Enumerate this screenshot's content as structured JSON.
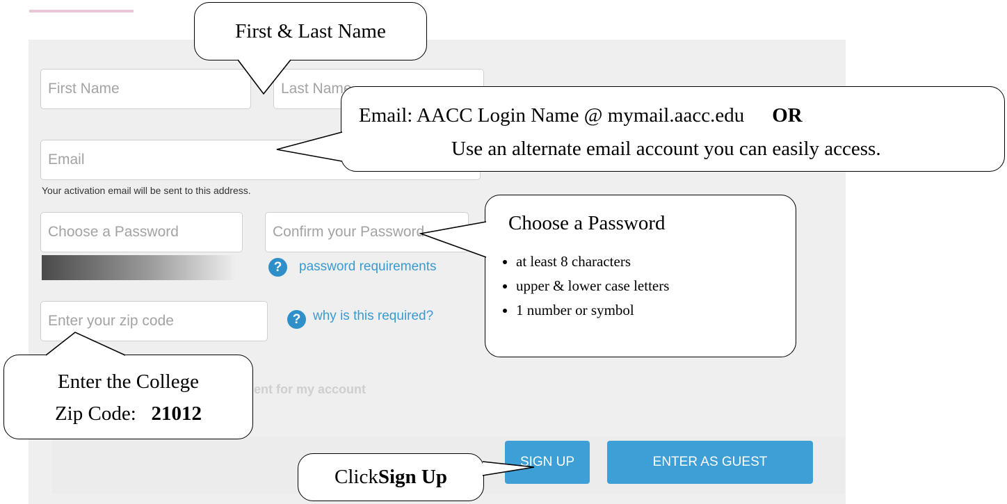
{
  "form": {
    "first_name_placeholder": "First Name",
    "last_name_placeholder": "Last Name",
    "email_placeholder": "Email",
    "email_hint": "Your activation email will be sent to this address.",
    "password_placeholder": "Choose a Password",
    "confirm_password_placeholder": "Confirm your Password",
    "password_requirements_link": "password requirements",
    "zip_placeholder": "Enter your zip code",
    "zip_help_link": "why is this required?",
    "consent_text_visible": "ent for my account",
    "sign_up_button": "SIGN UP",
    "guest_button": "ENTER AS GUEST"
  },
  "callouts": {
    "name": "First & Last Name",
    "email_line1_prefix": "Email:  AACC Login Name @ mymail.aacc.edu",
    "email_line1_or": "OR",
    "email_line2": "Use an alternate email account you can easily access.",
    "password_title": "Choose a Password",
    "password_rules": [
      "at least 8 characters",
      "upper & lower case letters",
      "1 number or symbol"
    ],
    "zip_line1": "Enter the College",
    "zip_line2_prefix": "Zip Code:",
    "zip_line2_code": "21012",
    "click_prefix": "Click ",
    "click_bold": "Sign Up"
  },
  "colors": {
    "panel": "#efefef",
    "button": "#3d9fd6",
    "link": "#3a9ad0",
    "help_icon": "#2f8fc9"
  },
  "icons": {
    "help": "question-circle-icon"
  }
}
